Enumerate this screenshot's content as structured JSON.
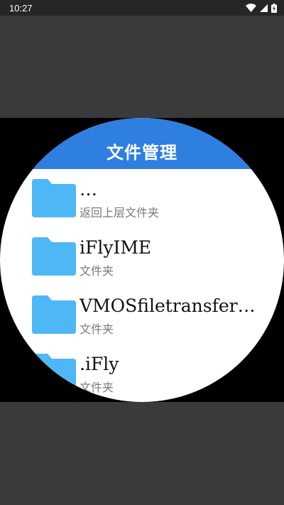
{
  "status_bar": {
    "time": "10:27",
    "icons": [
      "wifi-icon",
      "signal-icon",
      "battery-charging-icon"
    ]
  },
  "app": {
    "title": "文件管理",
    "accent_color": "#2e7fe0",
    "folder_color": "#4db8f5"
  },
  "files": [
    {
      "name": "…",
      "subtitle": "返回上层文件夹"
    },
    {
      "name": "iFlyIME",
      "subtitle": "文件夹"
    },
    {
      "name": "VMOSfiletransfer…",
      "subtitle": "文件夹"
    },
    {
      "name": ".iFly",
      "subtitle": "文件夹"
    }
  ]
}
